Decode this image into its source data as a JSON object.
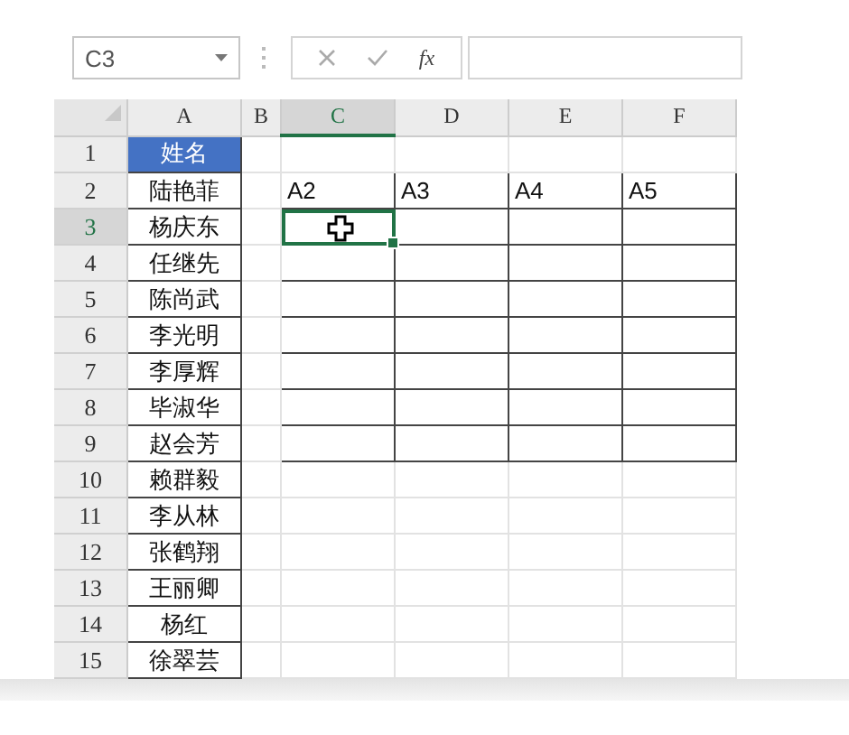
{
  "name_box": {
    "value": "C3"
  },
  "formula_bar": {
    "function_label": "fx"
  },
  "columns": [
    {
      "label": "A",
      "selected": false
    },
    {
      "label": "B",
      "selected": false
    },
    {
      "label": "C",
      "selected": true
    },
    {
      "label": "D",
      "selected": false
    },
    {
      "label": "E",
      "selected": false
    },
    {
      "label": "F",
      "selected": false
    }
  ],
  "rows": [
    {
      "header": "1",
      "selected": false,
      "name": "姓名",
      "highlighted": true,
      "framed": false
    },
    {
      "header": "2",
      "selected": false,
      "name": "陆艳菲",
      "highlighted": false,
      "cells": [
        "A2",
        "A3",
        "A4",
        "A5"
      ],
      "framed": true
    },
    {
      "header": "3",
      "selected": true,
      "name": "杨庆东",
      "highlighted": false,
      "framed": true
    },
    {
      "header": "4",
      "selected": false,
      "name": "任继先",
      "highlighted": false,
      "framed": true
    },
    {
      "header": "5",
      "selected": false,
      "name": "陈尚武",
      "highlighted": false,
      "framed": true
    },
    {
      "header": "6",
      "selected": false,
      "name": "李光明",
      "highlighted": false,
      "framed": true
    },
    {
      "header": "7",
      "selected": false,
      "name": "李厚辉",
      "highlighted": false,
      "framed": true
    },
    {
      "header": "8",
      "selected": false,
      "name": "毕淑华",
      "highlighted": false,
      "framed": true
    },
    {
      "header": "9",
      "selected": false,
      "name": "赵会芳",
      "highlighted": false,
      "framed": true
    },
    {
      "header": "10",
      "selected": false,
      "name": "赖群毅",
      "highlighted": false,
      "framed": false
    },
    {
      "header": "11",
      "selected": false,
      "name": "李从林",
      "highlighted": false,
      "framed": false
    },
    {
      "header": "12",
      "selected": false,
      "name": "张鹤翔",
      "highlighted": false,
      "framed": false
    },
    {
      "header": "13",
      "selected": false,
      "name": "王丽卿",
      "highlighted": false,
      "framed": false
    },
    {
      "header": "14",
      "selected": false,
      "name": "杨红",
      "highlighted": false,
      "framed": false
    },
    {
      "header": "15",
      "selected": false,
      "name": "徐翠芸",
      "highlighted": false,
      "framed": false
    }
  ]
}
